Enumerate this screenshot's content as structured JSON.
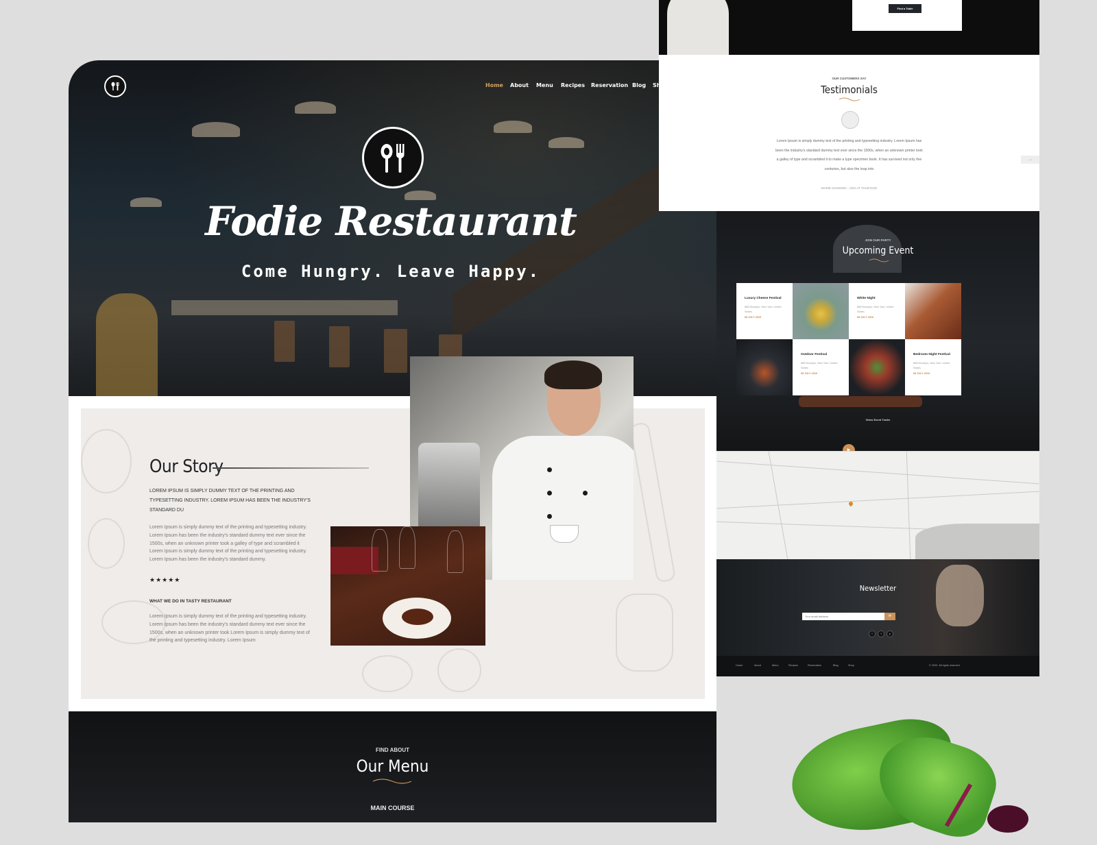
{
  "nav": {
    "items": [
      "Home",
      "About",
      "Menu",
      "Recipes",
      "Reservation",
      "Blog",
      "Shop"
    ],
    "active_index": 0,
    "accent_color": "#d4a35f"
  },
  "hero": {
    "title": "Fodie Restaurant",
    "tagline": "Come Hungry. Leave Happy."
  },
  "story": {
    "heading": "Our Story",
    "lead": "LOREM IPSUM IS SIMPLY DUMMY TEXT OF THE PRINTING AND TYPESETTING INDUSTRY. LOREM IPSUM HAS BEEN THE INDUSTRY'S STANDARD DU",
    "body": "Lorem Ipsum is simply dummy text of the printing and typesetting industry. Lorem Ipsum has been the industry's standard dummy text ever since the 1500s, when an unknown printer took a galley of type and scrambled it Lorem Ipsum is simply dummy text of the printing and typesetting industry. Lorem Ipsum has been the industry's standard dummy.",
    "rating": "★★★★★",
    "subheading": "WHAT WE DO IN TASTY RESTAURANT",
    "body2": "Lorem Ipsum is simply dummy text of the printing and typesetting industry. Lorem Ipsum has been the industry's standard dummy text ever since the 1500s, when an unknown printer took Lorem Ipsum is simply dummy text of the printing and typesetting industry. Lorem Ipsum"
  },
  "menu_section": {
    "pre": "FIND ABOUT",
    "heading": "Our Menu",
    "course": "MAIN COURSE"
  },
  "top_strip": {
    "button": "Find a Table"
  },
  "testimonials": {
    "pre": "OUR CUSTOMERS SAY",
    "title": "Testimonials",
    "quote": "Lorem Ipsum is simply dummy text of the printing and typesetting industry. Lorem Ipsum has been the industry's standard dummy text ever since the 1500s, when an unknown printer took a galley of type and scrambled it to make a type specimen book. It has survived not only five centuries, but also the leap into",
    "author": "MARIE DIAMOND - CEO AT THAIFOOD",
    "arrow": "→"
  },
  "events": {
    "pre": "JOIN OUR PARTY",
    "title": "Upcoming Event",
    "items": [
      {
        "name": "Luxury Cheese Festival",
        "address": "868 Brooklyn, New York, United States",
        "date": "08 JULY 2016"
      },
      {
        "name": "White Night",
        "address": "868 Brooklyn, New York, United States",
        "date": "08 JULY 2016"
      },
      {
        "name": "Outdoor Festival",
        "address": "868 Brooklyn, New York, United States",
        "date": "08 JULY 2016"
      },
      {
        "name": "Bedroom Night Festival",
        "address": "868 Brooklyn, New York, United States",
        "date": "08 JULY 2016"
      }
    ],
    "video_label": "Video Event Trailer",
    "play_icon": "▶"
  },
  "newsletter": {
    "title": "Newsletter",
    "placeholder": "Your email address",
    "submit_icon": "✉",
    "social": [
      "t",
      "f",
      "p"
    ]
  },
  "footer": {
    "links": [
      "Home",
      "About",
      "Menu",
      "Recipes",
      "Reservation",
      "Blog",
      "Shop"
    ],
    "copyright": "© 2020. All rights reserved."
  },
  "colors": {
    "accent": "#c9935a",
    "dark": "#111214",
    "panel": "#efecea"
  }
}
